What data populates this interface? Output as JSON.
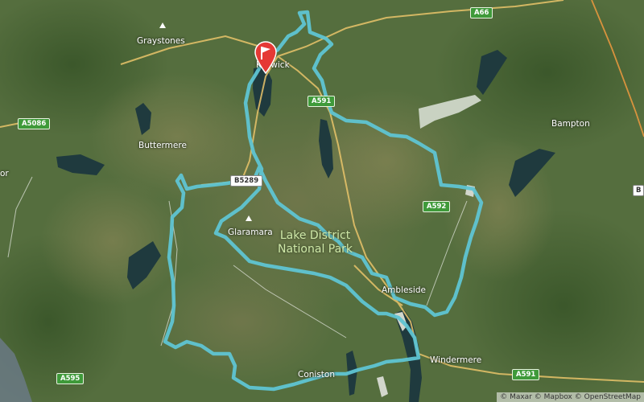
{
  "map": {
    "places": [
      {
        "id": "greystones",
        "label": "Graystones"
      },
      {
        "id": "keswick",
        "label": "Keswick"
      },
      {
        "id": "buttermere",
        "label": "Buttermere"
      },
      {
        "id": "bampton",
        "label": "Bampton"
      },
      {
        "id": "ambleside",
        "label": "Ambleside"
      },
      {
        "id": "windermere",
        "label": "Windermere"
      },
      {
        "id": "coniston",
        "label": "Coniston"
      },
      {
        "id": "glaramara",
        "label": "Glaramara"
      }
    ],
    "edge_labels": {
      "left": "or",
      "right": "B"
    },
    "park_label": {
      "line1": "Lake District",
      "line2": "National Park"
    },
    "roads": [
      {
        "id": "a66",
        "label": "A66"
      },
      {
        "id": "a5086",
        "label": "A5086"
      },
      {
        "id": "a591-north",
        "label": "A591"
      },
      {
        "id": "b5289",
        "label": "B5289"
      },
      {
        "id": "a592",
        "label": "A592"
      },
      {
        "id": "a595",
        "label": "A595"
      },
      {
        "id": "a591-south",
        "label": "A591"
      }
    ],
    "attribution": "© Maxar © Mapbox © OpenStreetMap",
    "colors": {
      "route": "#5fc4d3",
      "terrain": "#4f6a3c",
      "water": "#1f3a3e",
      "road": "#e9c46a",
      "marker": "#e53935",
      "road_shield": "#3f9a3a"
    },
    "marker": {
      "icon": "flag-icon",
      "label": "start"
    }
  }
}
